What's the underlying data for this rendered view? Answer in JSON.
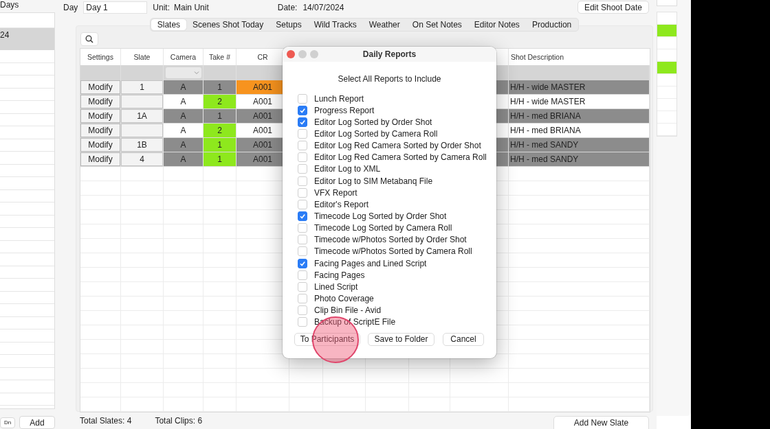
{
  "days_panel": {
    "title": "Days",
    "items": [
      {
        "label": "24",
        "selected": true
      }
    ],
    "buttons": [
      {
        "label": "Dn"
      },
      {
        "label": "Add"
      }
    ]
  },
  "top_bar": {
    "day_label": "Day",
    "day_value": "Day 1",
    "unit_label": "Unit:",
    "unit_value": "Main Unit",
    "date_label": "Date:",
    "date_value": "14/07/2024",
    "edit_button": "Edit Shoot Date"
  },
  "tabs": [
    {
      "label": "Slates",
      "selected": true
    },
    {
      "label": "Scenes Shot Today",
      "selected": false
    },
    {
      "label": "Setups",
      "selected": false
    },
    {
      "label": "Wild Tracks",
      "selected": false
    },
    {
      "label": "Weather",
      "selected": false
    },
    {
      "label": "On Set Notes",
      "selected": false
    },
    {
      "label": "Editor Notes",
      "selected": false
    },
    {
      "label": "Production",
      "selected": false
    }
  ],
  "table": {
    "columns": [
      "Settings",
      "Slate",
      "Camera",
      "Take #",
      "CR",
      "Shot Description"
    ],
    "rows": [
      {
        "button": "Modify",
        "slate": "1",
        "camera": "A",
        "take": "1",
        "take_good": false,
        "cr": "A001",
        "cr_flagged": true,
        "shot_description": "H/H - wide MASTER",
        "shaded": true
      },
      {
        "button": "Modify",
        "camera": "A",
        "take": "2",
        "take_good": true,
        "cr": "A001",
        "cr_flagged": false,
        "shot_description": "H/H - wide MASTER",
        "shaded": false
      },
      {
        "button": "Modify",
        "slate": "1A",
        "camera": "A",
        "take": "1",
        "take_good": false,
        "cr": "A001",
        "cr_flagged": false,
        "shot_description": "H/H - med BRIANA",
        "shaded": true
      },
      {
        "button": "Modify",
        "camera": "A",
        "take": "2",
        "take_good": true,
        "cr": "A001",
        "cr_flagged": false,
        "shot_description": "H/H - med BRIANA",
        "shaded": false
      },
      {
        "button": "Modify",
        "slate": "1B",
        "camera": "A",
        "take": "1",
        "take_good": true,
        "cr": "A001",
        "cr_flagged": false,
        "shot_description": "H/H - med SANDY",
        "shaded": true
      },
      {
        "button": "Modify",
        "slate": "4",
        "camera": "A",
        "take": "1",
        "take_good": true,
        "cr": "A001",
        "cr_flagged": false,
        "shot_description": "H/H - med SANDY",
        "shaded": true
      }
    ]
  },
  "footer": {
    "total_slates": "Total Slates: 4",
    "total_clips": "Total Clips: 6",
    "add_button": "Add New Slate"
  },
  "side_window": {
    "rows": [
      {
        "highlighted": false
      },
      {
        "highlighted": true
      },
      {
        "highlighted": false
      },
      {
        "highlighted": false
      },
      {
        "highlighted": true
      },
      {
        "highlighted": false
      },
      {
        "highlighted": false
      },
      {
        "highlighted": false
      },
      {
        "highlighted": false
      },
      {
        "highlighted": false
      }
    ]
  },
  "dialog": {
    "title": "Daily Reports",
    "subtitle": "Select All Reports to Include",
    "options": [
      {
        "label": "Lunch Report",
        "checked": false
      },
      {
        "label": "Progress Report",
        "checked": true
      },
      {
        "label": "Editor Log Sorted by Order Shot",
        "checked": true
      },
      {
        "label": "Editor Log Sorted by Camera Roll",
        "checked": false
      },
      {
        "label": "Editor Log Red Camera Sorted by Order Shot",
        "checked": false
      },
      {
        "label": "Editor Log Red Camera Sorted by Camera Roll",
        "checked": false
      },
      {
        "label": "Editor Log to XML",
        "checked": false
      },
      {
        "label": "Editor Log to SIM Metabanq File",
        "checked": false
      },
      {
        "label": "VFX Report",
        "checked": false
      },
      {
        "label": "Editor's Report",
        "checked": false
      },
      {
        "label": "Timecode Log Sorted by Order Shot",
        "checked": true
      },
      {
        "label": "Timecode Log Sorted by Camera Roll",
        "checked": false
      },
      {
        "label": "Timecode w/Photos Sorted by Order Shot",
        "checked": false
      },
      {
        "label": "Timecode w/Photos Sorted by Camera Roll",
        "checked": false
      },
      {
        "label": "Facing Pages and Lined Script",
        "checked": true
      },
      {
        "label": "Facing Pages",
        "checked": false
      },
      {
        "label": "Lined Script",
        "checked": false
      },
      {
        "label": "Photo Coverage",
        "checked": false
      },
      {
        "label": "Clip Bin File - Avid",
        "checked": false
      },
      {
        "label": "Backup of ScriptE File",
        "checked": false
      }
    ],
    "buttons": [
      {
        "label": "To Participants"
      },
      {
        "label": "Save to Folder"
      },
      {
        "label": "Cancel"
      }
    ]
  }
}
